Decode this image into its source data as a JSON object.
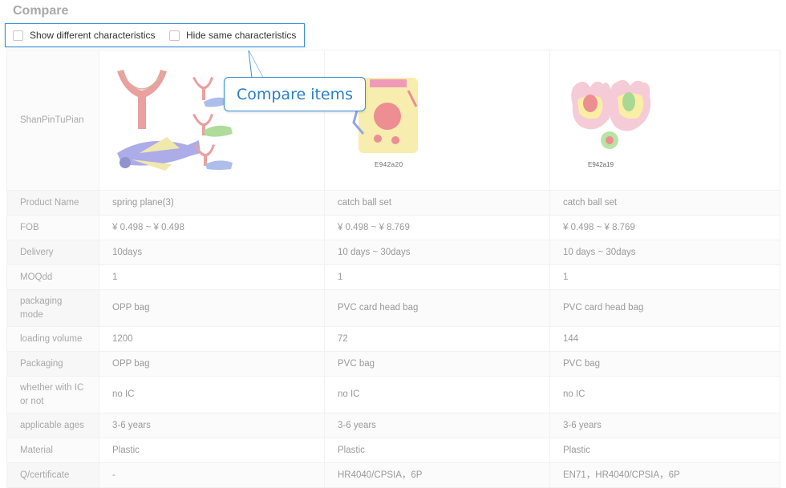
{
  "page": {
    "title": "Compare"
  },
  "filters": {
    "show_different": "Show different characteristics",
    "hide_same": "Hide same characteristics"
  },
  "callout": {
    "text": "Compare items"
  },
  "image_row_label": "ShanPinTuPian",
  "products": [
    {
      "image_caption": "",
      "image_icon": "slingshot-and-plane-image"
    },
    {
      "image_caption": "E942a20",
      "image_icon": "catch-ball-set-image"
    },
    {
      "image_caption": "E942a19",
      "image_icon": "catch-ball-gloves-image"
    }
  ],
  "rows": [
    {
      "label": "Product Name",
      "values": [
        "spring plane(3)",
        "catch ball set",
        "catch ball set"
      ]
    },
    {
      "label": "FOB",
      "values": [
        "¥ 0.498  ~  ¥ 0.498",
        "¥ 0.498  ~  ¥ 8.769",
        "¥ 0.498  ~  ¥ 8.769"
      ]
    },
    {
      "label": "Delivery",
      "values": [
        "10days",
        "10 days  ~  30days",
        "10 days  ~  30days"
      ]
    },
    {
      "label": "MOQdd",
      "values": [
        "1",
        "1",
        "1"
      ]
    },
    {
      "label": "packaging mode",
      "values": [
        "OPP bag",
        "PVC card head bag",
        "PVC card head bag"
      ]
    },
    {
      "label": "loading volume",
      "values": [
        "1200",
        "72",
        "144"
      ]
    },
    {
      "label": "Packaging",
      "values": [
        "OPP bag",
        "PVC bag",
        "PVC bag"
      ]
    },
    {
      "label": "whether with IC or not",
      "values": [
        "no IC",
        "no IC",
        "no IC"
      ]
    },
    {
      "label": "applicable ages",
      "values": [
        "3-6 years",
        "3-6 years",
        "3-6 years"
      ]
    },
    {
      "label": "Material",
      "values": [
        "Plastic",
        "Plastic",
        "Plastic"
      ]
    },
    {
      "label": "Q/certificate",
      "values": [
        "-",
        "HR4040/CPSIA，6P",
        "EN71，HR4040/CPSIA，6P"
      ]
    }
  ],
  "colors": {
    "accent": "#3b8fd3",
    "link": "#9fcbea",
    "price": "#e9a1a9"
  }
}
